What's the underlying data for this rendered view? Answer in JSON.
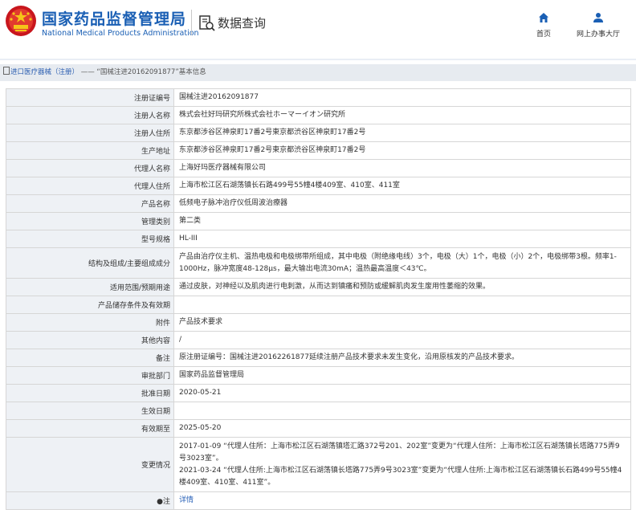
{
  "header": {
    "brand_cn": "国家药品监督管理局",
    "brand_en": "National Medical Products Administration",
    "query_title": "数据查询",
    "nav": [
      {
        "label": "首页",
        "icon": "home-icon"
      },
      {
        "label": "网上办事大厅",
        "icon": "user-icon"
      }
    ]
  },
  "breadcrumb": {
    "link": "进口医疗器械（注册）",
    "separator": " —— ",
    "current": "“国械注进20162091877”基本信息"
  },
  "colors": {
    "brand": "#1a5fb4",
    "label_bg": "#eef1f5",
    "crumb_bg": "#e7ebf0",
    "link": "#2a62b8"
  },
  "rows": [
    {
      "label": "注册证编号",
      "value": "国械注进20162091877"
    },
    {
      "label": "注册人名称",
      "value": "株式会社好玛研究所株式会社ホーマーイオン研究所"
    },
    {
      "label": "注册人住所",
      "value": "东京都涉谷区神泉町17番2号東京都渋谷区神泉町17番2号"
    },
    {
      "label": "生产地址",
      "value": "东京都涉谷区神泉町17番2号東京都渋谷区神泉町17番2号"
    },
    {
      "label": "代理人名称",
      "value": "上海好玛医疗器械有限公司"
    },
    {
      "label": "代理人住所",
      "value": "上海市松江区石湖荡镇长石路499号55幢4楼409室、410室、411室"
    },
    {
      "label": "产品名称",
      "value": "低频电子脉冲治疗仪低周波治療器"
    },
    {
      "label": "管理类别",
      "value": "第二类"
    },
    {
      "label": "型号规格",
      "value": "HL-III"
    },
    {
      "label": "结构及组成/主要组成成分",
      "value": "产品由治疗仪主机、温热电极和电极绑带所组成，其中电极（附绝缘电线）3个，电极（大）1个，电极（小）2个，电极绑带3根。频率1-1000Hz，脉冲宽度48-128μs，最大输出电流30mA；温热最高温度＜43℃。"
    },
    {
      "label": "适用范围/预期用途",
      "value": "通过皮肤，对神经以及肌肉进行电刺激，从而达到镇痛和预防或缓解肌肉发生废用性萎缩的效果。"
    },
    {
      "label": "产品储存条件及有效期",
      "value": ""
    },
    {
      "label": "附件",
      "value": "产品技术要求"
    },
    {
      "label": "其他内容",
      "value": "/"
    },
    {
      "label": "备注",
      "value": "原注册证编号：国械注进20162261877延续注册产品技术要求未发生变化，沿用原核发的产品技术要求。"
    },
    {
      "label": "审批部门",
      "value": "国家药品监督管理局"
    },
    {
      "label": "批准日期",
      "value": "2020-05-21"
    },
    {
      "label": "生效日期",
      "value": ""
    },
    {
      "label": "有效期至",
      "value": "2025-05-20"
    }
  ],
  "changes": {
    "label": "变更情况",
    "entries": [
      "2017-01-09 “代理人住所：上海市松江区石湖荡镇塔汇路372号201、202室”变更为“代理人住所：上海市松江区石湖荡镇长塔路775弄9号3023室”。",
      "2021-03-24 “代理人住所:上海市松江区石湖荡镇长塔路775弄9号3023室”变更为“代理人住所:上海市松江区石湖荡镇长石路499号55幢4楼409室、410室、411室”。"
    ]
  },
  "note": {
    "label": "注",
    "link": "详情"
  }
}
